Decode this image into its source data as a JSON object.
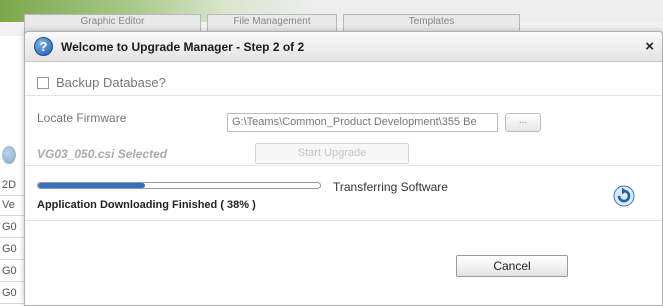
{
  "background": {
    "tabs": [
      "Graphic Editor",
      "File Management",
      "Templates"
    ],
    "rows": [
      "2D",
      "Ve",
      "G0",
      "G0",
      "G0",
      "G0"
    ]
  },
  "dialog": {
    "title": "Welcome to Upgrade Manager - Step 2 of 2",
    "help_icon_glyph": "?",
    "close_glyph": "×",
    "backup_label": "Backup Database?",
    "backup_checked": false,
    "firmware_label": "Locate Firmware",
    "firmware_path": "G:\\Teams\\Common_Product Development\\355 Be",
    "browse_label": "...",
    "selected_file": "VG03_050.csi Selected",
    "start_label": "Start Upgrade",
    "transfer_status": "Transferring Software",
    "progress_caption": "Application Downloading Finished  ( 38% )",
    "progress_fraction": 0.38,
    "cancel_label": "Cancel"
  },
  "colors": {
    "progress_fill": "#2f73c2",
    "help_icon": "#1e5ea8"
  },
  "icons": {
    "help": "question-circle-icon",
    "close": "close-icon",
    "refresh": "refresh-icon"
  }
}
